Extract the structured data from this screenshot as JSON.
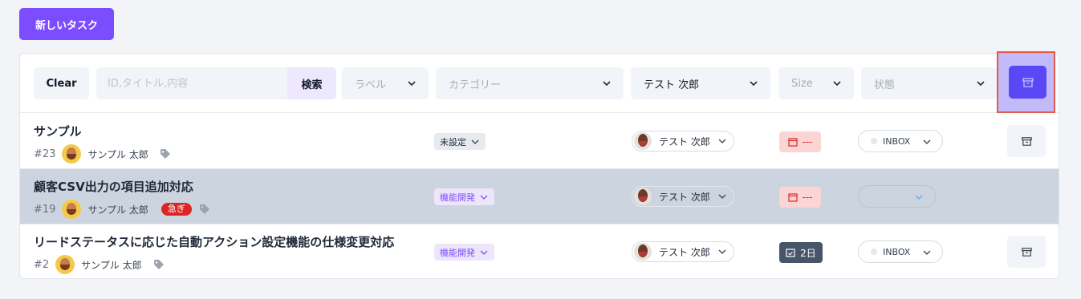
{
  "header": {
    "new_task_label": "新しいタスク"
  },
  "filters": {
    "clear_label": "Clear",
    "search_placeholder": "ID,タイトル,内容",
    "search_button_label": "検索",
    "label_select": "ラベル",
    "category_select": "カテゴリー",
    "assignee_select": "テスト 次郎",
    "size_select": "Size",
    "status_select": "状態"
  },
  "colors": {
    "accent": "#7c4dff",
    "archive_button": "#5a47f5",
    "urgent": "#dc2626",
    "selected_row": "#ccd4df"
  },
  "tasks": [
    {
      "title": "サンプル",
      "number": "#23",
      "owner": "サンプル 太郎",
      "badge": "",
      "category": "未設定",
      "assignee": "テスト 次郎",
      "due": "---",
      "status": "INBOX"
    },
    {
      "title": "顧客CSV出力の項目追加対応",
      "number": "#19",
      "owner": "サンプル 太郎",
      "badge": "急ぎ",
      "category": "機能開発",
      "assignee": "テスト 次郎",
      "due": "---",
      "status": ""
    },
    {
      "title": "リードステータスに応じた自動アクション設定機能の仕様変更対応",
      "number": "#2",
      "owner": "サンプル 太郎",
      "badge": "",
      "category": "機能開発",
      "assignee": "テスト 次郎",
      "due": "2日",
      "status": "INBOX"
    }
  ]
}
